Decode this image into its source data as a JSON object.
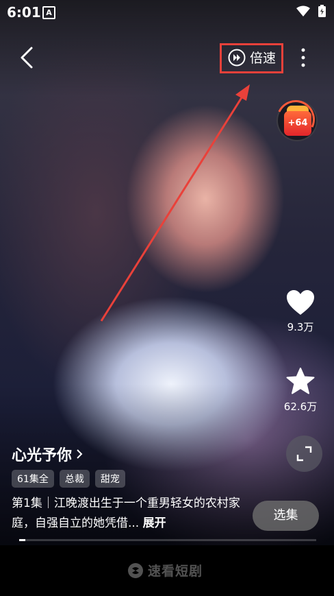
{
  "status_bar": {
    "time": "6:01",
    "notification_badge": "A"
  },
  "top_bar": {
    "speed_label": "倍速"
  },
  "reward": {
    "value": "+64"
  },
  "actions": {
    "like_count": "9.3万",
    "favorite_count": "62.6万"
  },
  "drama": {
    "title": "心光予你",
    "tags": [
      "61集全",
      "总裁",
      "甜宠"
    ],
    "description": "第1集｜江晚渡出生于一个重男轻女的农村家庭，自强自立的她凭借...",
    "expand_label": "展开",
    "episodes_button": "选集"
  },
  "progress": {
    "fraction": 0.02
  },
  "footer": {
    "watermark": "速看短剧"
  },
  "colors": {
    "highlight": "#e9413a",
    "reward": "#e2262b"
  }
}
